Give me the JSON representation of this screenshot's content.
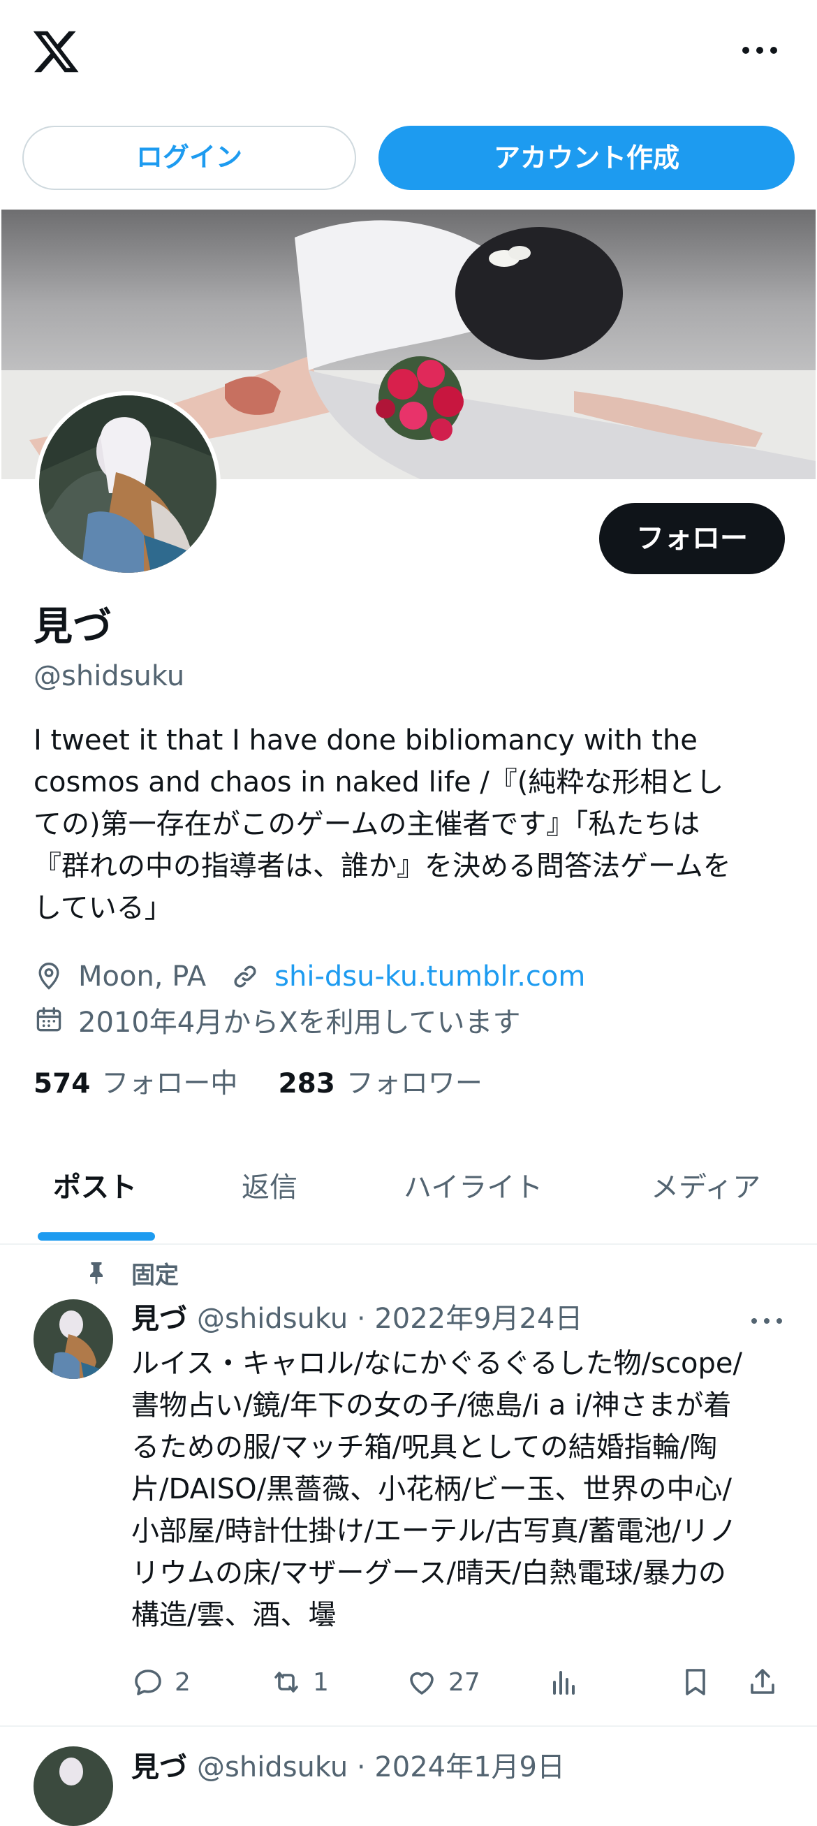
{
  "header": {
    "logo_icon": "x-logo-icon",
    "more_icon": "more-horizontal-icon"
  },
  "auth": {
    "login_label": "ログイン",
    "signup_label": "アカウント作成"
  },
  "profile": {
    "name": "見づ",
    "handle": "@shidsuku",
    "follow_label": "フォロー",
    "bio": "I tweet it that I have done bibliomancy with the\ncosmos and chaos in naked life /『(純粋な形相とし\nての)第一存在がこのゲームの主催者です』「私たちは\n『群れの中の指導者は、誰か』を決める問答法ゲームを\nしている」",
    "location": "Moon, PA",
    "website": "shi-dsu-ku.tumblr.com",
    "joined": "2010年4月からXを利用しています",
    "following_count": "574",
    "following_label": "フォロー中",
    "followers_count": "283",
    "followers_label": "フォロワー"
  },
  "tabs": [
    {
      "label": "ポスト",
      "active": true
    },
    {
      "label": "返信",
      "active": false
    },
    {
      "label": "ハイライト",
      "active": false
    },
    {
      "label": "メディア",
      "active": false
    }
  ],
  "pinned_post": {
    "pinned_label": "固定",
    "name": "見づ",
    "handle_date": "@shidsuku · 2022年9月24日",
    "text": "ルイス・キャロル/なにかぐるぐるした物/scope/\n書物占い/鏡/年下の女の子/徳島/i a i/神さまが着\nるための服/マッチ箱/呪具としての結婚指輪/陶\n片/DAISO/黒薔薇、小花柄/ビー玉、世界の中心/\n小部屋/時計仕掛け/エーテル/古写真/蓄電池/リノ\nリウムの床/マザーグース/晴天/白熱電球/暴力の\n構造/雲、酒、壜",
    "replies": "2",
    "reposts": "1",
    "likes": "27"
  },
  "next_post": {
    "name": "見づ",
    "handle_date": "@shidsuku · 2024年1月9日"
  },
  "colors": {
    "accent": "#1d9bf0",
    "text": "#0f1419",
    "secondary": "#536471",
    "border": "#cfd9de"
  }
}
